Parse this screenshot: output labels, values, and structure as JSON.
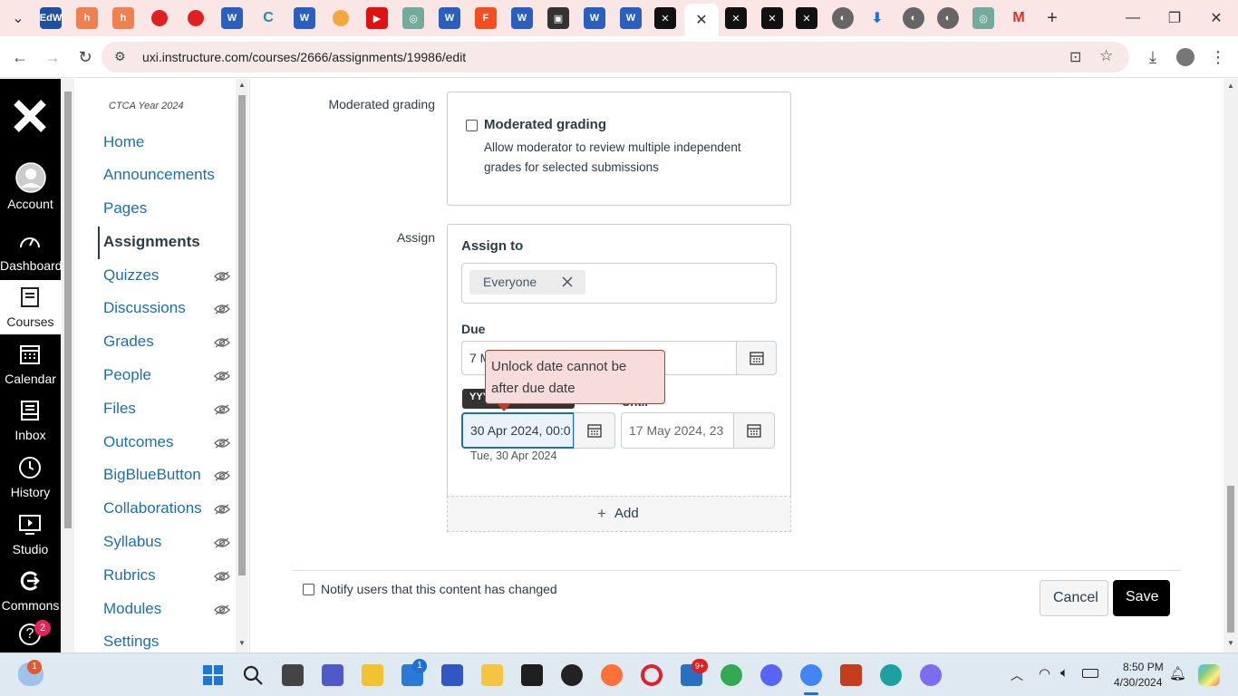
{
  "browser": {
    "url": "uxi.instructure.com/courses/2666/assignments/19986/edit",
    "active_tab_close": "✕",
    "new_tab": "+"
  },
  "global_nav": {
    "items": [
      {
        "label": "Account",
        "icon": "account-icon"
      },
      {
        "label": "Dashboard",
        "icon": "dashboard-icon"
      },
      {
        "label": "Courses",
        "icon": "courses-icon"
      },
      {
        "label": "Calendar",
        "icon": "calendar-icon"
      },
      {
        "label": "Inbox",
        "icon": "inbox-icon"
      },
      {
        "label": "History",
        "icon": "history-icon"
      },
      {
        "label": "Studio",
        "icon": "studio-icon"
      },
      {
        "label": "Commons",
        "icon": "commons-icon"
      }
    ],
    "help_badge": "2",
    "help_label": "?"
  },
  "course_nav": {
    "term": "CTCA Year 2024",
    "items": [
      {
        "label": "Home",
        "hidden": false
      },
      {
        "label": "Announcements",
        "hidden": false
      },
      {
        "label": "Pages",
        "hidden": false
      },
      {
        "label": "Assignments",
        "hidden": false,
        "active": true
      },
      {
        "label": "Quizzes",
        "hidden": true
      },
      {
        "label": "Discussions",
        "hidden": true
      },
      {
        "label": "Grades",
        "hidden": true
      },
      {
        "label": "People",
        "hidden": true
      },
      {
        "label": "Files",
        "hidden": true
      },
      {
        "label": "Outcomes",
        "hidden": true
      },
      {
        "label": "BigBlueButton",
        "hidden": true
      },
      {
        "label": "Collaborations",
        "hidden": true
      },
      {
        "label": "Syllabus",
        "hidden": true
      },
      {
        "label": "Rubrics",
        "hidden": true
      },
      {
        "label": "Modules",
        "hidden": true
      },
      {
        "label": "Settings",
        "hidden": false
      }
    ]
  },
  "moderated": {
    "label": "Moderated grading",
    "checkbox_label": "Moderated grading",
    "description": "Allow moderator to review multiple independent grades for selected submissions"
  },
  "assign": {
    "label": "Assign",
    "assign_to_title": "Assign to",
    "chip": "Everyone",
    "due_label": "Due",
    "due_value": "7 M",
    "available_from_value": "30 Apr 2024, 00:0",
    "available_from_hint": "Tue, 30 Apr 2024",
    "until_label": "Until",
    "until_value": "17 May 2024, 23",
    "tooltip_badge": "YYY",
    "error_message": "Unlock date cannot be after due date",
    "add_label": "Add"
  },
  "footer": {
    "notify_label": "Notify users that this content has changed",
    "cancel_label": "Cancel",
    "save_label": "Save"
  },
  "taskbar": {
    "time": "8:50 PM",
    "date": "4/30/2024",
    "store_badge": "1",
    "weather_badge": "1",
    "notif_badge": "9+"
  }
}
